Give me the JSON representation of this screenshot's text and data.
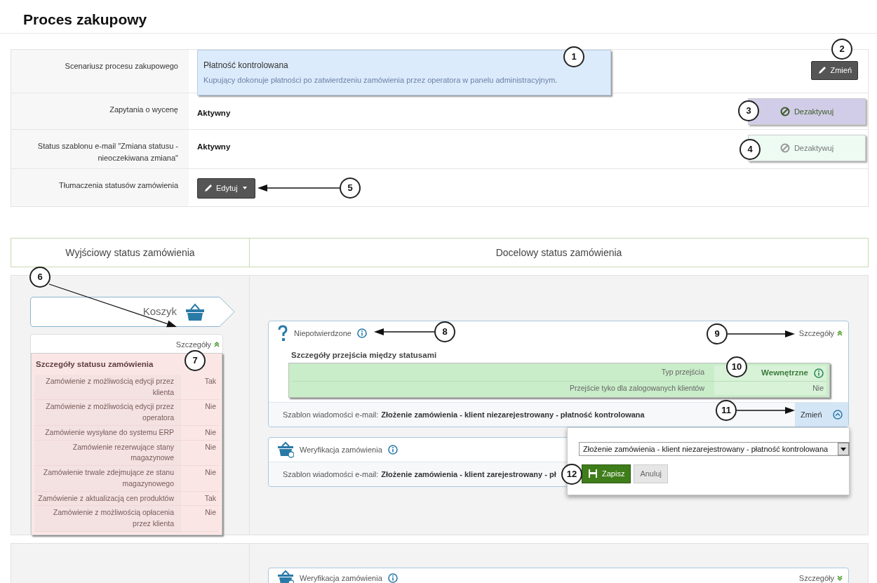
{
  "page_title": "Proces zakupowy",
  "settings": [
    {
      "kind": "scenario",
      "label": "Scenariusz procesu zakupowego",
      "scenario_title": "Płatność kontrolowana",
      "scenario_description": "Kupujący dokonuje płatności po zatwierdzeniu zamówienia przez operatora w panelu administracyjnym.",
      "button": "Zmień"
    },
    {
      "kind": "toggle",
      "label": "Zapytania o wycenę",
      "value": "Aktywny",
      "button": "Dezaktywuj",
      "highlighted": true
    },
    {
      "kind": "toggle",
      "label": "Status szablonu e-mail \"Zmiana statusu - nieoczekiwana zmiana\"",
      "value": "Aktywny",
      "button": "Dezaktywuj",
      "highlighted": false
    },
    {
      "kind": "dropdown",
      "label": "Tłumaczenia statusów zamówienia",
      "button": "Edytuj"
    }
  ],
  "columns": [
    "Wyjściowy status zamówienia",
    "Docelowy status zamówienia"
  ],
  "source_status": {
    "name": "Koszyk",
    "details_link": "Szczegóły",
    "expanded": true,
    "details_title": "Szczegóły statusu zamówienia",
    "details": [
      {
        "label": "Zamówienie z możliwością edycji przez klienta",
        "value": "Tak"
      },
      {
        "label": "Zamówienie z możliwością edycji przez operatora",
        "value": "Nie"
      },
      {
        "label": "Zamówienie wysyłane do systemu ERP",
        "value": "Nie"
      },
      {
        "label": "Zamówienie rezerwujące stany magazynowe",
        "value": "Nie"
      },
      {
        "label": "Zamówienie trwale zdejmujące ze stanu magazynowego",
        "value": "Nie"
      },
      {
        "label": "Zamówienie z aktualizacją cen produktów",
        "value": "Tak"
      },
      {
        "label": "Zamówienie z możliwością opłacenia przez klienta",
        "value": "Nie"
      }
    ]
  },
  "transitions": [
    {
      "kind": "question",
      "name": "Niepotwierdzone",
      "details_link": "Szczegóły",
      "expanded": true,
      "details_title": "Szczegóły przejścia między statusami",
      "details": [
        {
          "label": "Typ przejścia",
          "value": "Wewnętrzne",
          "info": true
        },
        {
          "label": "Przejście tyko dla zalogowanych klientów",
          "value": "Nie",
          "info": false
        }
      ],
      "template_label": "Szablon wiadomości e-mail:",
      "template": "Złożenie zamówienia - klient niezarejestrowany - płatność kontrolowana",
      "change_link": "Zmień",
      "popup": {
        "select_value": "Złożenie zamówienia - klient niezarejestrowany - płatność kontrolowana",
        "save": "Zapisz",
        "cancel": "Anuluj"
      }
    },
    {
      "kind": "basket",
      "name": "Weryfikacja zamówienia",
      "template_label": "Szablon wiadomości e-mail:",
      "template": "Złożenie zamówienia - klient zarejestrowany - pł"
    }
  ],
  "next_row": {
    "transitions": [
      {
        "kind": "basket",
        "name": "Weryfikacja zamówienia",
        "details_link": "Szczegóły",
        "expanded": false
      }
    ]
  },
  "callouts": [
    "1",
    "2",
    "3",
    "4",
    "5",
    "6",
    "7",
    "8",
    "9",
    "10",
    "11",
    "12"
  ]
}
